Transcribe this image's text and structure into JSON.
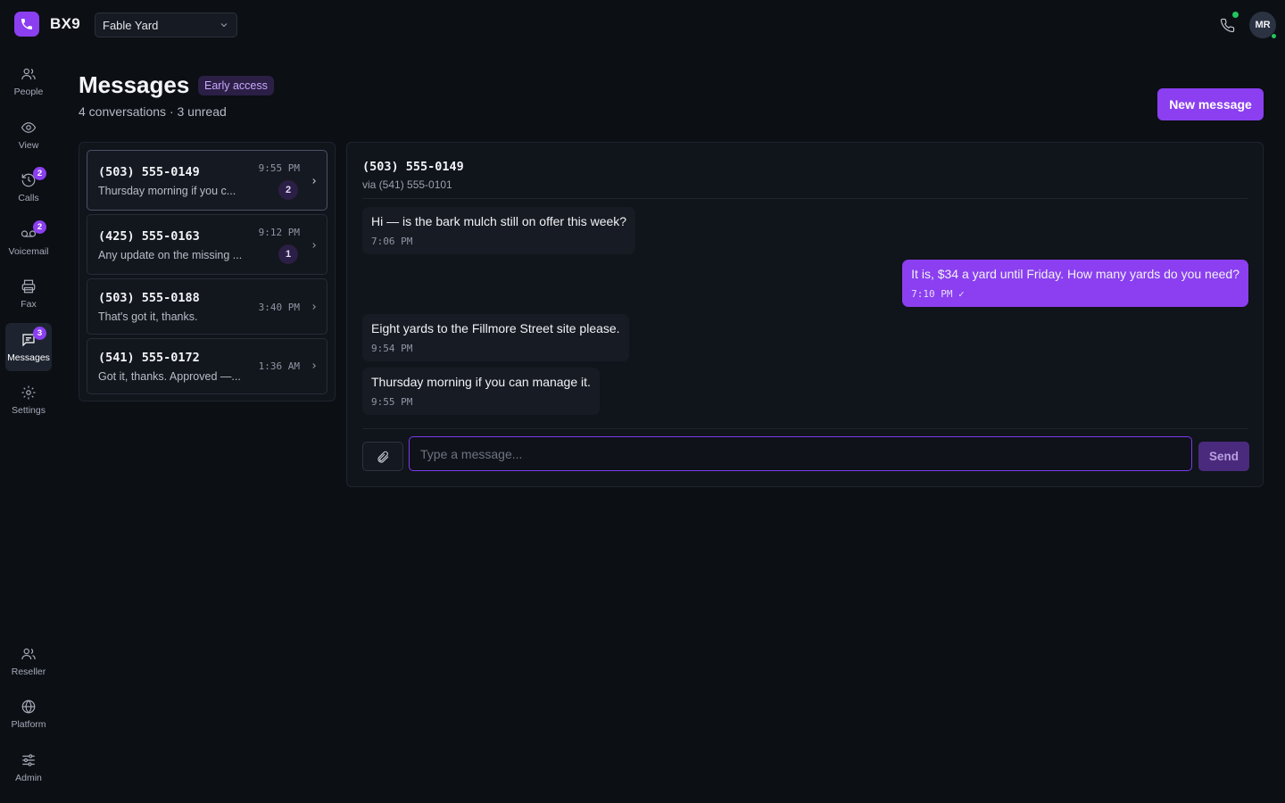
{
  "app": {
    "brand": "BX9",
    "workspace": "Fable Yard",
    "user_initials": "MR",
    "accent_color": "#8b3ff0"
  },
  "sidebar": {
    "items": [
      {
        "id": "people",
        "label": "People",
        "icon": "people-icon",
        "badge": ""
      },
      {
        "id": "view",
        "label": "View",
        "icon": "eye-icon",
        "badge": ""
      },
      {
        "id": "calls",
        "label": "Calls",
        "icon": "history-icon",
        "badge": "2"
      },
      {
        "id": "voicemail",
        "label": "Voicemail",
        "icon": "voicemail-icon",
        "badge": "2"
      },
      {
        "id": "fax",
        "label": "Fax",
        "icon": "printer-icon",
        "badge": ""
      },
      {
        "id": "messages",
        "label": "Messages",
        "icon": "message-icon",
        "badge": "3"
      },
      {
        "id": "settings",
        "label": "Settings",
        "icon": "gear-icon",
        "badge": ""
      }
    ],
    "bottom_items": [
      {
        "id": "reseller",
        "label": "Reseller",
        "icon": "people-icon"
      },
      {
        "id": "platform",
        "label": "Platform",
        "icon": "globe-icon"
      },
      {
        "id": "admin",
        "label": "Admin",
        "icon": "sliders-icon"
      }
    ]
  },
  "header": {
    "title": "Messages",
    "badge": "Early access",
    "subtitle": "4 conversations · 3 unread",
    "new_message_label": "New message"
  },
  "conversations": [
    {
      "number": "(503) 555-0149",
      "preview": "Thursday morning if you c...",
      "time": "9:55 PM",
      "unread": "2",
      "active": true
    },
    {
      "number": "(425) 555-0163",
      "preview": "Any update on the missing ...",
      "time": "9:12 PM",
      "unread": "1",
      "active": false
    },
    {
      "number": "(503) 555-0188",
      "preview": "That's got it, thanks.",
      "time": "3:40 PM",
      "unread": "",
      "active": false
    },
    {
      "number": "(541) 555-0172",
      "preview": "Got it, thanks. Approved —...",
      "time": "1:36 AM",
      "unread": "",
      "active": false
    }
  ],
  "chat": {
    "contact": "(503) 555-0149",
    "via": "via (541) 555-0101",
    "messages": [
      {
        "direction": "in",
        "text": "Hi — is the bark mulch still on offer this week?",
        "time": "7:06 PM"
      },
      {
        "direction": "out",
        "text": "It is, $34 a yard until Friday. How many yards do you need?",
        "time": "7:10 PM ✓"
      },
      {
        "direction": "in",
        "text": "Eight yards to the Fillmore Street site please.",
        "time": "9:54 PM"
      },
      {
        "direction": "in",
        "text": "Thursday morning if you can manage it.",
        "time": "9:55 PM"
      }
    ],
    "input_placeholder": "Type a message...",
    "input_value": "",
    "send_label": "Send"
  }
}
